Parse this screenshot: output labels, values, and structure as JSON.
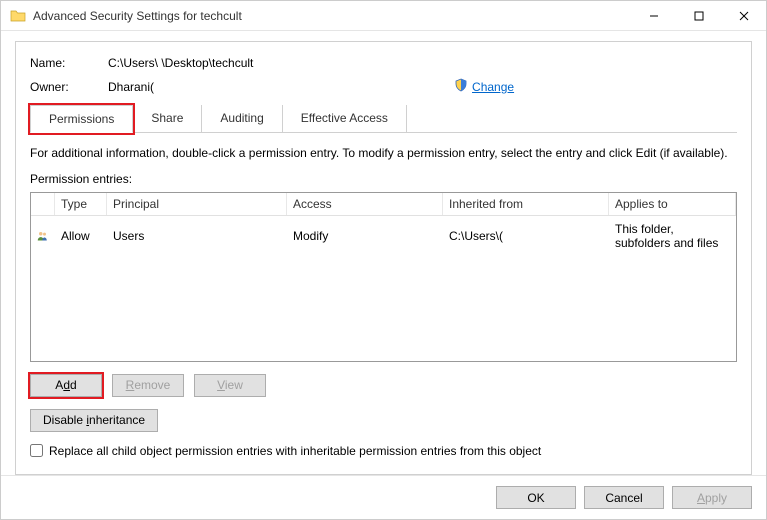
{
  "window": {
    "title": "Advanced Security Settings for techcult"
  },
  "info": {
    "name_label": "Name:",
    "name_value": "C:\\Users\\                            \\Desktop\\techcult",
    "owner_label": "Owner:",
    "owner_value": "Dharani(",
    "change_link": "Change"
  },
  "tabs": {
    "permissions": "Permissions",
    "share": "Share",
    "auditing": "Auditing",
    "effective": "Effective Access"
  },
  "body": {
    "helptext": "For additional information, double-click a permission entry. To modify a permission entry, select the entry and click Edit (if available).",
    "entries_label": "Permission entries:"
  },
  "grid": {
    "headers": {
      "blank": "",
      "type": "Type",
      "principal": "Principal",
      "access": "Access",
      "inherited": "Inherited from",
      "applies": "Applies to"
    },
    "row": {
      "type": "Allow",
      "principal": "Users",
      "access": "Modify",
      "inherited": "C:\\Users\\(",
      "applies": "This folder, subfolders and files"
    }
  },
  "buttons": {
    "add": "Add",
    "remove": "Remove",
    "view": "View",
    "disable_inherit": "Disable inheritance",
    "replace_label": "Replace all child object permission entries with inheritable permission entries from this object"
  },
  "footer": {
    "ok": "OK",
    "cancel": "Cancel",
    "apply": "Apply"
  }
}
